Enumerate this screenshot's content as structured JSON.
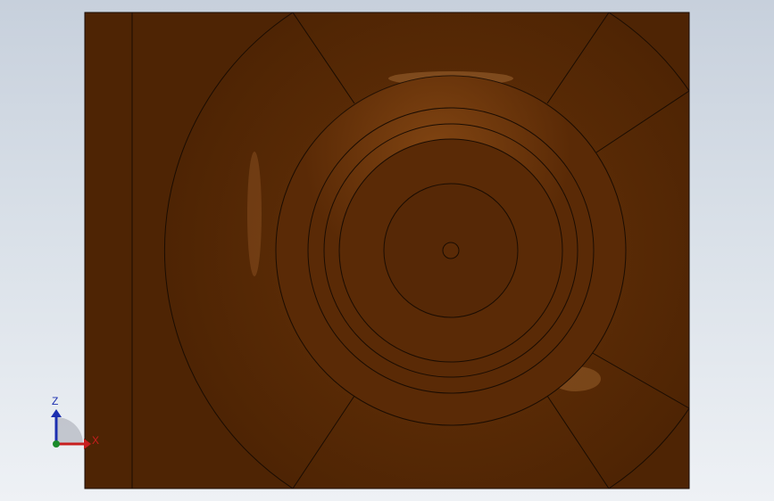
{
  "scene": {
    "part_color": "#5a2a06",
    "highlight_color": "#8a4a14",
    "edge_color": "#1a0c02"
  },
  "triad": {
    "z_label": "Z",
    "x_label": "X",
    "z_color": "#1c2fb0",
    "x_color": "#c81e1e",
    "origin_color": "#1a8a2a"
  }
}
